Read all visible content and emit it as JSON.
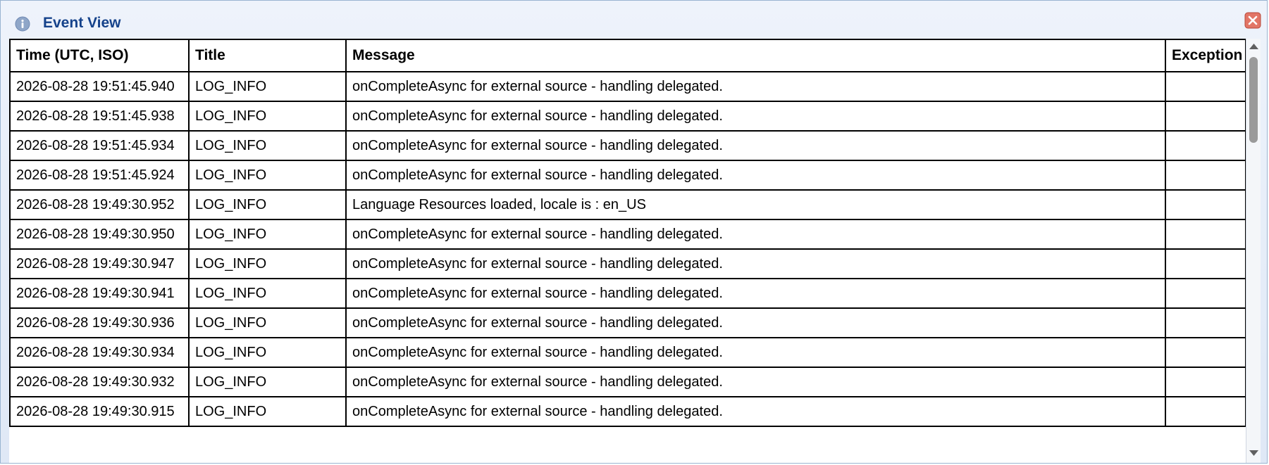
{
  "window": {
    "title": "Event View",
    "icons": {
      "info": "info-icon",
      "close": "close-icon"
    }
  },
  "grid": {
    "columns": [
      "Time (UTC, ISO)",
      "Title",
      "Message",
      "Exception"
    ],
    "rows": [
      {
        "time": "2026-08-28 19:51:45.940",
        "title": "LOG_INFO",
        "message": "onCompleteAsync for external source - handling delegated.",
        "exception": ""
      },
      {
        "time": "2026-08-28 19:51:45.938",
        "title": "LOG_INFO",
        "message": "onCompleteAsync for external source - handling delegated.",
        "exception": ""
      },
      {
        "time": "2026-08-28 19:51:45.934",
        "title": "LOG_INFO",
        "message": "onCompleteAsync for external source - handling delegated.",
        "exception": ""
      },
      {
        "time": "2026-08-28 19:51:45.924",
        "title": "LOG_INFO",
        "message": "onCompleteAsync for external source - handling delegated.",
        "exception": ""
      },
      {
        "time": "2026-08-28 19:49:30.952",
        "title": "LOG_INFO",
        "message": "Language Resources loaded, locale is : en_US",
        "exception": ""
      },
      {
        "time": "2026-08-28 19:49:30.950",
        "title": "LOG_INFO",
        "message": "onCompleteAsync for external source - handling delegated.",
        "exception": ""
      },
      {
        "time": "2026-08-28 19:49:30.947",
        "title": "LOG_INFO",
        "message": "onCompleteAsync for external source - handling delegated.",
        "exception": ""
      },
      {
        "time": "2026-08-28 19:49:30.941",
        "title": "LOG_INFO",
        "message": "onCompleteAsync for external source - handling delegated.",
        "exception": ""
      },
      {
        "time": "2026-08-28 19:49:30.936",
        "title": "LOG_INFO",
        "message": "onCompleteAsync for external source - handling delegated.",
        "exception": ""
      },
      {
        "time": "2026-08-28 19:49:30.934",
        "title": "LOG_INFO",
        "message": "onCompleteAsync for external source - handling delegated.",
        "exception": ""
      },
      {
        "time": "2026-08-28 19:49:30.932",
        "title": "LOG_INFO",
        "message": "onCompleteAsync for external source - handling delegated.",
        "exception": ""
      },
      {
        "time": "2026-08-28 19:49:30.915",
        "title": "LOG_INFO",
        "message": "onCompleteAsync for external source - handling delegated.",
        "exception": ""
      }
    ]
  },
  "colors": {
    "title_text": "#15428b",
    "window_border": "#99b4d1",
    "close_button": "#e27566",
    "info_icon": "#8fa6c8"
  }
}
